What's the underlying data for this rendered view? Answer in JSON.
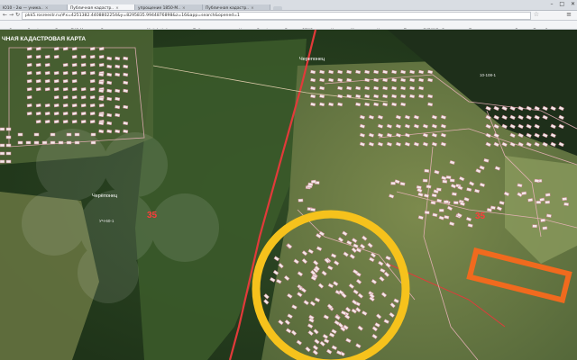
{
  "browser": {
    "tabs": [
      {
        "label": "Ю10 - 2ю — уника..",
        "active": false
      },
      {
        "label": "Публичная кадастр..",
        "active": true
      },
      {
        "label": "упрощение 1850-М..",
        "active": false
      },
      {
        "label": "Публичная кадастр..",
        "active": false
      }
    ],
    "address": "pkk5.rosreestr.ru/#x=4251382.4408802254&y=8295835.9944876898&z=16&app=search&opened=1",
    "bookmarks": [
      "Сервисы Google",
      "Яндекс ЯКО Москва",
      "Валютные дохо",
      "Мой Activity",
      "Публичная",
      "Новости Google",
      "Главная 2ГИС",
      "Карточка Мемори",
      "Консультант Плюс",
      "СИРИУС - Законод",
      "Поиск делового",
      "Дневник Папы О"
    ]
  },
  "map": {
    "header_text": "ЧНАЯ КАДАСТРОВАЯ КАРТА",
    "labels": {
      "district_number_left": "35",
      "district_number_right": "35",
      "village_left": "Черёпонец",
      "village_left_code": "УЧ-60-1",
      "village_top": "Черепонец",
      "village_top_right_code": "10-108-1"
    },
    "colors": {
      "highlight_circle": "#f6c21c",
      "highlight_rectangle": "#f06a1e",
      "road": "#e23a3a",
      "parcel_border": "#ffd7dc"
    }
  }
}
